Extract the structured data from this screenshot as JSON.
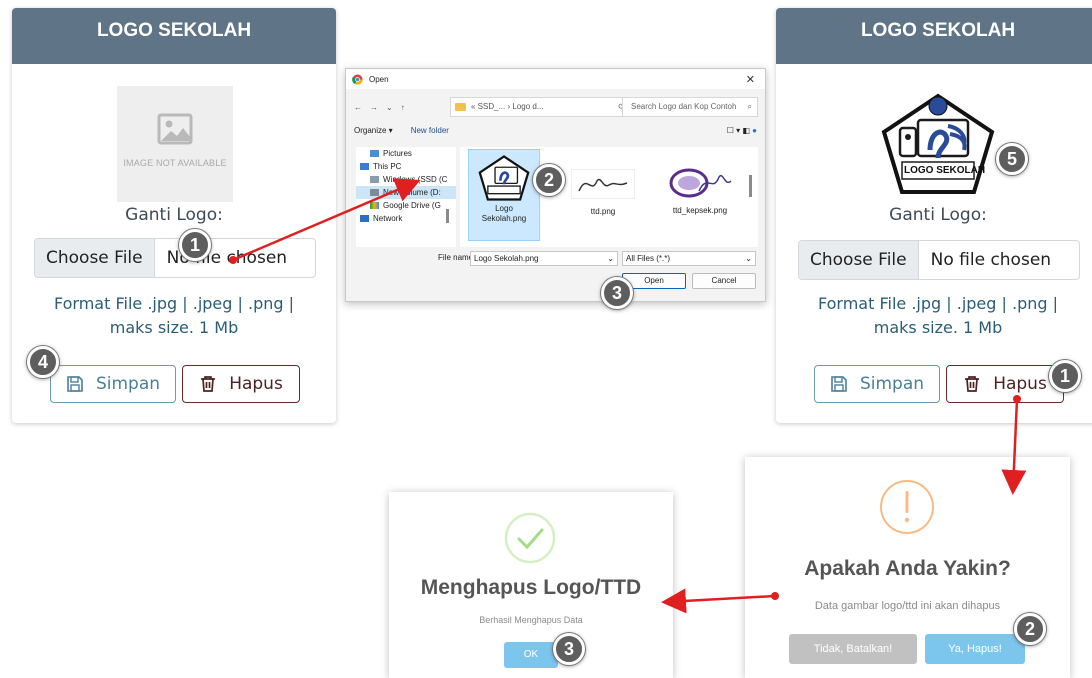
{
  "left_card": {
    "header": "LOGO SEKOLAH",
    "image_placeholder_text": "IMAGE NOT AVAILABLE",
    "change_label": "Ganti Logo:",
    "choose_file_label": "Choose File",
    "file_status": "No file chosen",
    "format_line1": "Format File .jpg | .jpeg | .png |",
    "format_line2": "maks size. 1 Mb",
    "save_label": "Simpan",
    "delete_label": "Hapus"
  },
  "right_card": {
    "header": "LOGO SEKOLAH",
    "logo_text": "LOGO SEKOLAH",
    "change_label": "Ganti Logo:",
    "choose_file_label": "Choose File",
    "file_status": "No file chosen",
    "format_line1": "Format File .jpg | .jpeg | .png |",
    "format_line2": "maks size. 1 Mb",
    "save_label": "Simpan",
    "delete_label": "Hapus"
  },
  "file_dialog": {
    "title": "Open",
    "path": "« SSD_... › Logo d...",
    "search_placeholder": "Search Logo dan Kop Contoh",
    "organize_label": "Organize ▾",
    "new_folder_label": "New folder",
    "tree_items": [
      "Pictures",
      "This PC",
      "Windows (SSD (C",
      "New Volume (D:",
      "Google Drive (G",
      "Network"
    ],
    "files": [
      "Logo Sekolah.png",
      "ttd.png",
      "ttd_kepsek.png"
    ],
    "file_name_label": "File name:",
    "file_name_value": "Logo Sekolah.png",
    "file_type_value": "All Files (*.*)",
    "open_label": "Open",
    "cancel_label": "Cancel"
  },
  "confirm_modal": {
    "title": "Apakah Anda Yakin?",
    "text": "Data gambar logo/ttd ini akan dihapus",
    "cancel_label": "Tidak, Batalkan!",
    "confirm_label": "Ya, Hapus!",
    "icon": "warning-icon",
    "icon_color": "#f8bb86",
    "confirm_color": "#7cc6ee",
    "cancel_color": "#c1c1c1"
  },
  "success_modal": {
    "title": "Menghapus Logo/TTD",
    "text": "Berhasil Menghapus Data",
    "ok_label": "OK",
    "icon": "check-icon",
    "icon_color": "#a5dc86"
  },
  "badges": {
    "left_1": "1",
    "dialog_2": "2",
    "dialog_3": "3",
    "left_4": "4",
    "right_5": "5",
    "right_1": "1",
    "confirm_2": "2",
    "success_3": "3"
  },
  "colors": {
    "header_bg": "#5f7487",
    "arrow": "#e02020",
    "format_text": "#2b5d78"
  }
}
